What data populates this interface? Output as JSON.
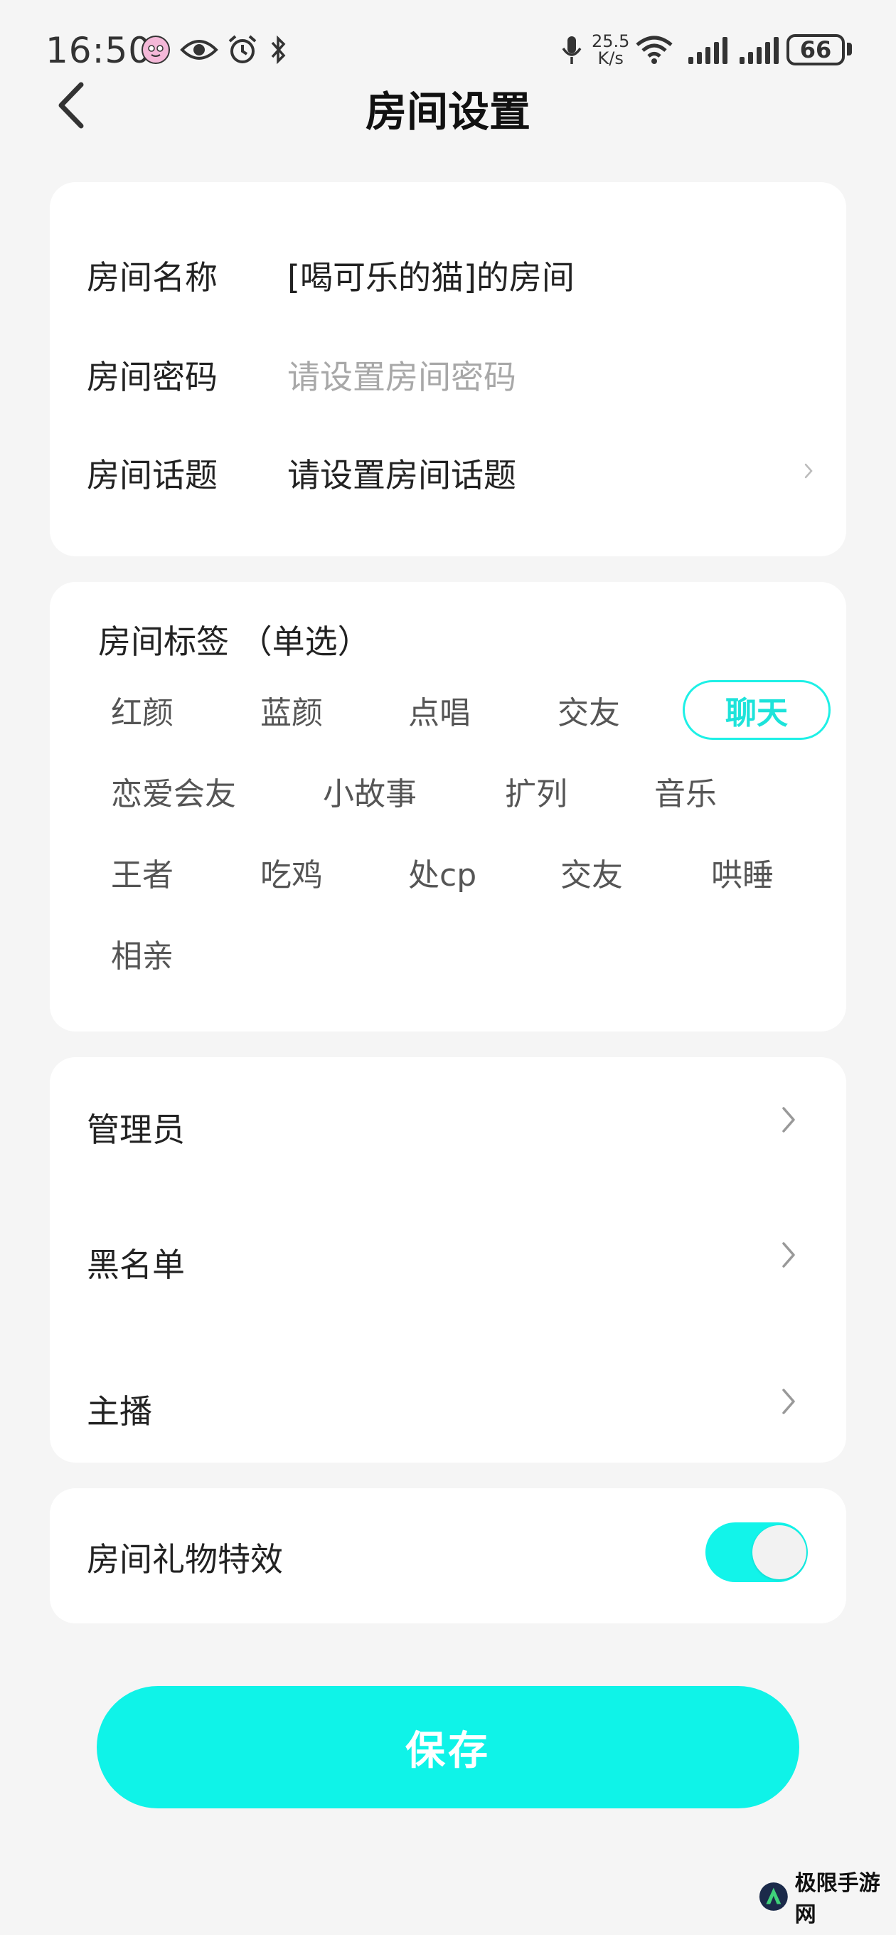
{
  "status_bar": {
    "time": "16:50",
    "net_speed_value": "25.5",
    "net_speed_unit": "K/s",
    "battery": "66",
    "icons": [
      "app-avatar-icon",
      "eye-icon",
      "alarm-icon",
      "bluetooth-icon",
      "microphone-icon",
      "wifi-icon",
      "signal-icon",
      "signal-icon"
    ]
  },
  "header": {
    "title": "房间设置",
    "back_icon": "chevron-left-icon"
  },
  "room_info": {
    "name_label": "房间名称",
    "name_value": "[喝可乐的猫]的房间",
    "password_label": "房间密码",
    "password_placeholder": "请设置房间密码",
    "topic_label": "房间话题",
    "topic_value": "请设置房间话题"
  },
  "tags": {
    "title": "房间标签 （单选）",
    "items": [
      "红颜",
      "蓝颜",
      "点唱",
      "交友",
      "聊天",
      "恋爱会友",
      "小故事",
      "扩列",
      "音乐",
      "王者",
      "吃鸡",
      "处cp",
      "交友",
      "哄睡",
      "相亲"
    ],
    "selected": "聊天",
    "accent_color": "#1de3da"
  },
  "management": {
    "admin_label": "管理员",
    "blacklist_label": "黑名单",
    "anchor_label": "主播"
  },
  "gift_effects": {
    "label": "房间礼物特效",
    "enabled": true,
    "toggle_color": "#12f4ea"
  },
  "save_button": {
    "label": "保存",
    "color": "#0ff3e8"
  },
  "watermark": {
    "text": "极限手游网"
  }
}
